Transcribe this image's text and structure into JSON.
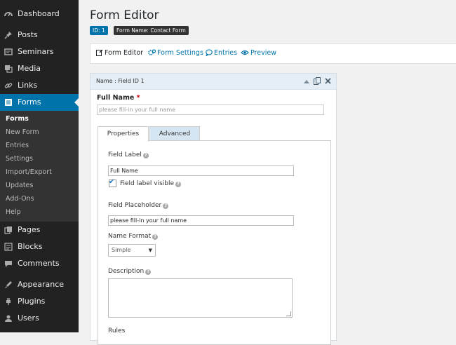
{
  "sidebar": {
    "items_top": [
      {
        "label": "Dashboard",
        "icon": "dashboard-icon"
      },
      {
        "label": "Posts",
        "icon": "pin-icon"
      },
      {
        "label": "Seminars",
        "icon": "seminars-icon"
      },
      {
        "label": "Media",
        "icon": "media-icon"
      },
      {
        "label": "Links",
        "icon": "link-icon"
      },
      {
        "label": "Forms",
        "icon": "forms-icon"
      }
    ],
    "submenu": [
      "Forms",
      "New Form",
      "Entries",
      "Settings",
      "Import/Export",
      "Updates",
      "Add-Ons",
      "Help"
    ],
    "items_bottom": [
      {
        "label": "Pages",
        "icon": "pages-icon"
      },
      {
        "label": "Blocks",
        "icon": "blocks-icon"
      },
      {
        "label": "Comments",
        "icon": "comment-icon"
      },
      {
        "label": "Appearance",
        "icon": "appearance-icon"
      },
      {
        "label": "Plugins",
        "icon": "plugin-icon"
      },
      {
        "label": "Users",
        "icon": "users-icon"
      }
    ]
  },
  "header": {
    "title": "Form Editor",
    "id_badge": "ID: 1",
    "name_badge": "Form Name: Contact Form"
  },
  "toolbar": {
    "form_editor": "Form Editor",
    "form_settings": "Form Settings",
    "entries": "Entries",
    "preview": "Preview"
  },
  "field": {
    "header_label": "Name : Field ID 1",
    "label": "Full Name",
    "required_mark": "*",
    "placeholder": "please fill-in your full name",
    "tabs": {
      "properties": "Properties",
      "advanced": "Advanced"
    },
    "properties": {
      "field_label_title": "Field Label",
      "field_label_value": "Full Name",
      "label_visible_text": "Field label visible",
      "label_visible_checked": true,
      "placeholder_title": "Field Placeholder",
      "placeholder_value": "please fill-in your full name",
      "name_format_title": "Name Format",
      "name_format_value": "Simple",
      "description_title": "Description",
      "description_value": "",
      "rules_title": "Rules"
    }
  },
  "colors": {
    "accent": "#0073aa",
    "sidebar_bg": "#222222",
    "submenu_bg": "#333333",
    "field_header_bg": "#e5eef5",
    "advanced_tab_bg": "#d5e6f2"
  }
}
